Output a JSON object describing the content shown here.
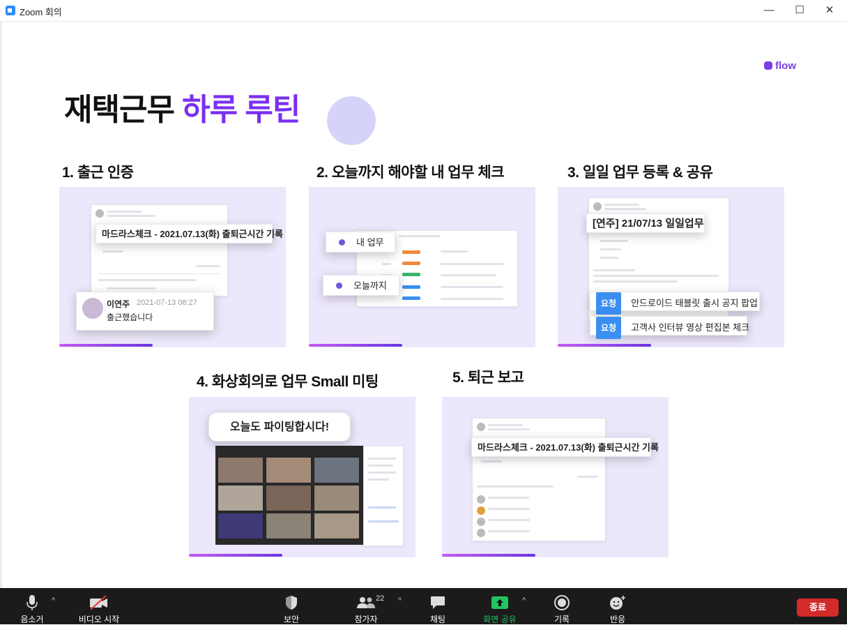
{
  "window": {
    "title": "Zoom 회의",
    "min_glyph": "—",
    "max_glyph": "☐",
    "close_glyph": "✕"
  },
  "slide": {
    "brand": "flow",
    "title_part1": "재택근무",
    "title_part2": "하루 루틴",
    "steps": [
      {
        "label": "1. 출근 인증",
        "callout": "마드라스체크 - 2021.07.13(화) 출퇴근시간 기록",
        "comment_name": "이연주",
        "comment_time": "2021-07-13 08:27",
        "comment_text": "출근했습니다"
      },
      {
        "label": "2. 오늘까지 해야할 내 업무 체크",
        "pill1": "내 업무",
        "pill2": "오늘까지"
      },
      {
        "label": "3. 일일 업무 등록 & 공유",
        "callout": "[연주] 21/07/13 일일업무",
        "tag": "요청",
        "item1": "안드로이드 태블릿 출시 공지 팝업",
        "item2": "고객사 인터뷰 영상 편집본 체크"
      },
      {
        "label": "4. 화상회의로 업무 Small 미팅",
        "bubble": "오늘도 파이팅합시다!"
      },
      {
        "label": "5. 퇴근 보고",
        "callout": "마드라스체크 - 2021.07.13(화) 출퇴근시간 기록"
      }
    ]
  },
  "toolbar": {
    "mute": "음소거",
    "video": "비디오 시작",
    "security": "보안",
    "participants": "참가자",
    "participants_count": "22",
    "chat": "채팅",
    "share": "화면 공유",
    "record": "기록",
    "reactions": "반응",
    "end": "종료",
    "share_color": "#22c55e",
    "end_color": "#d32a2a"
  }
}
